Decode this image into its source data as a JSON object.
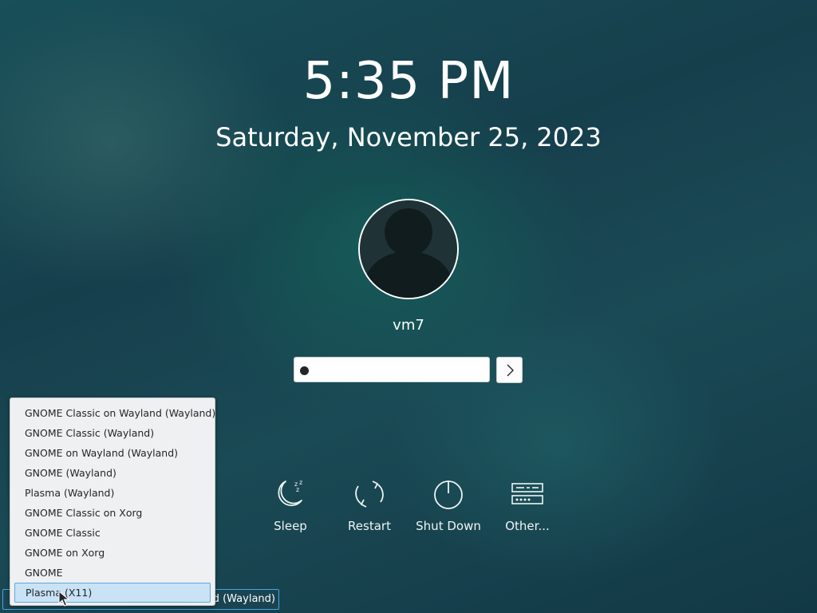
{
  "clock": {
    "time": "5:35 PM",
    "date": "Saturday, November 25, 2023"
  },
  "user": {
    "name": "vm7",
    "avatar_icon": "user-avatar-icon"
  },
  "login": {
    "password_masked": "●",
    "submit_icon": "chevron-right-icon"
  },
  "actions": [
    {
      "label": "Sleep",
      "icon": "sleep-icon"
    },
    {
      "label": "Restart",
      "icon": "restart-icon"
    },
    {
      "label": "Shut Down",
      "icon": "shutdown-icon"
    },
    {
      "label": "Other...",
      "icon": "other-icon"
    }
  ],
  "session": {
    "button_label": "nd (Wayland)",
    "menu_items": [
      "GNOME Classic on Wayland (Wayland)",
      "GNOME Classic (Wayland)",
      "GNOME on Wayland (Wayland)",
      "GNOME (Wayland)",
      "Plasma (Wayland)",
      "GNOME Classic on Xorg",
      "GNOME Classic",
      "GNOME on Xorg",
      "GNOME",
      "Plasma (X11)"
    ],
    "selected_item": "Plasma (X11)"
  },
  "colors": {
    "accent": "#4aa3df",
    "menu_background": "#eff0f1",
    "selection": "#c9e2f5"
  }
}
